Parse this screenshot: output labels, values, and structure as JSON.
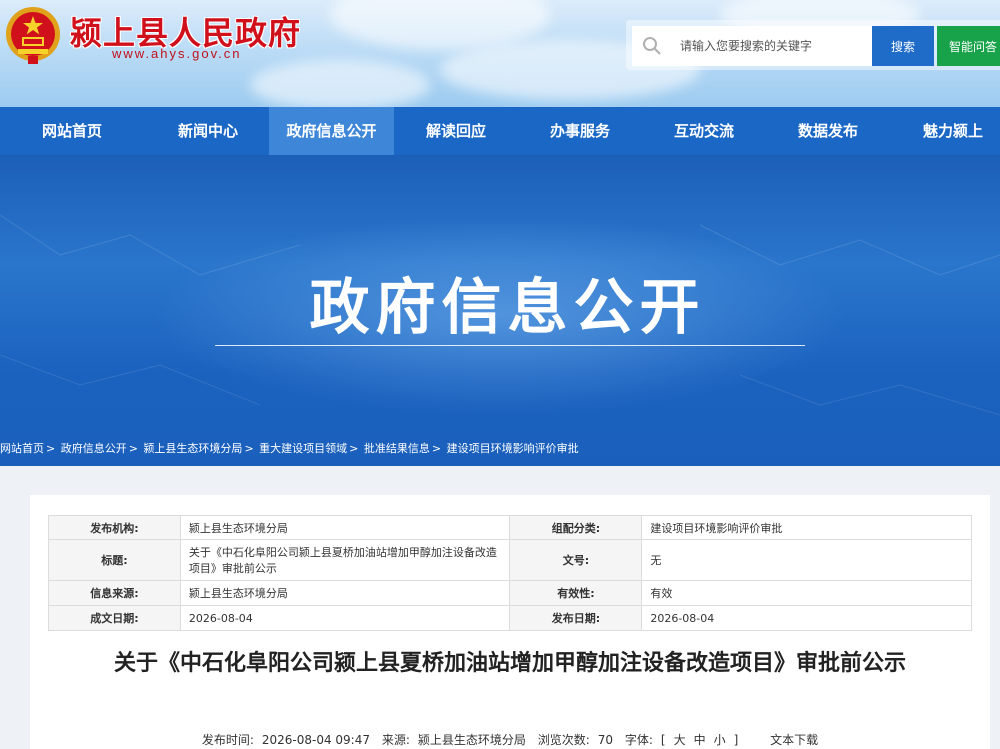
{
  "header": {
    "site_title": "颍上县人民政府",
    "site_url": "www.ahys.gov.cn",
    "search_placeholder": "请输入您要搜索的关键字",
    "search_label": "搜索",
    "ai_label": "智能问答",
    "icons": {
      "emblem": "national-emblem-icon",
      "search": "search-icon"
    }
  },
  "nav": {
    "items": [
      {
        "label": "网站首页"
      },
      {
        "label": "新闻中心"
      },
      {
        "label": "政府信息公开"
      },
      {
        "label": "解读回应"
      },
      {
        "label": "办事服务"
      },
      {
        "label": "互动交流"
      },
      {
        "label": "数据发布"
      },
      {
        "label": "魅力颍上"
      }
    ],
    "active_index": 2
  },
  "banner": {
    "title": "政府信息公开"
  },
  "breadcrumb": {
    "items": [
      "网站首页",
      "政府信息公开",
      "颍上县生态环境分局",
      "重大建设项目领域",
      "批准结果信息",
      "建设项目环境影响评价审批"
    ],
    "separator": ">"
  },
  "meta": {
    "publisher_label": "发布机构:",
    "publisher_value": "颍上县生态环境分局",
    "category_label": "组配分类:",
    "category_value": "建设项目环境影响评价审批",
    "title_label": "标题:",
    "title_value": "关于《中石化阜阳公司颍上县夏桥加油站增加甲醇加注设备改造项目》审批前公示",
    "doc_no_label": "文号:",
    "doc_no_value": "无",
    "source_label": "信息来源:",
    "source_value": "颍上县生态环境分局",
    "validity_label": "有效性:",
    "validity_value": "有效",
    "created_label": "成文日期:",
    "created_value": "2026-08-04",
    "published_label": "发布日期:",
    "published_value": "2026-08-04"
  },
  "article": {
    "title": "关于《中石化阜阳公司颍上县夏桥加油站增加甲醇加注设备改造项目》审批前公示",
    "publish_time_label": "发布时间:",
    "publish_time": "2026-08-04 09:47",
    "source_label": "来源:",
    "source": "颍上县生态环境分局",
    "views_label": "浏览次数:",
    "views": "70",
    "font_label": "字体:",
    "font_open": "[",
    "font_large": "大",
    "font_medium": "中",
    "font_small": "小",
    "font_close": "]",
    "text_download": "文本下载"
  },
  "colors": {
    "nav_bg": "#1a67c6",
    "nav_active": "#3d86d8",
    "search_btn": "#1e6bc8",
    "ai_btn": "#18a34a",
    "title_red": "#d0101a"
  }
}
